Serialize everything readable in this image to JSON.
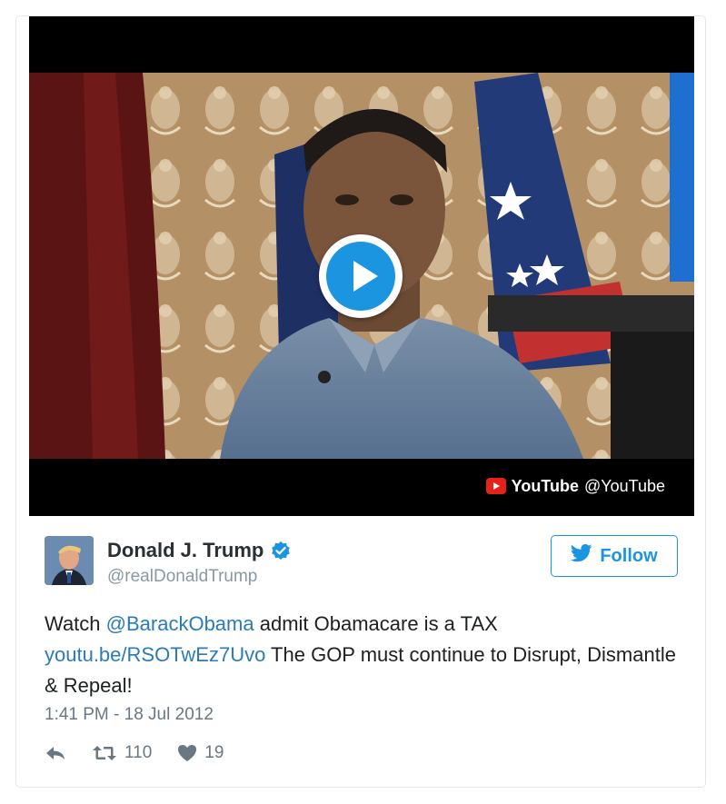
{
  "video": {
    "provider_name": "YouTube",
    "provider_handle": "@YouTube",
    "play_icon": "play-icon"
  },
  "tweet": {
    "author": {
      "display_name": "Donald J. Trump",
      "handle": "@realDonaldTrump",
      "verified": true
    },
    "follow_label": "Follow",
    "text": {
      "part1": "Watch ",
      "mention": "@BarackObama",
      "part2": " admit Obamacare is a TAX",
      "link": "youtu.be/RSOTwEz7Uvo",
      "part3": " The GOP must continue to Disrupt, Dismantle & Repeal!"
    },
    "timestamp": "1:41 PM - 18 Jul 2012",
    "actions": {
      "retweets": "110",
      "likes": "19"
    }
  },
  "colors": {
    "accent": "#1b95e0",
    "link": "#2b7bb9",
    "text": "#1c2022",
    "muted": "#697882",
    "youtube_red": "#e62117"
  }
}
